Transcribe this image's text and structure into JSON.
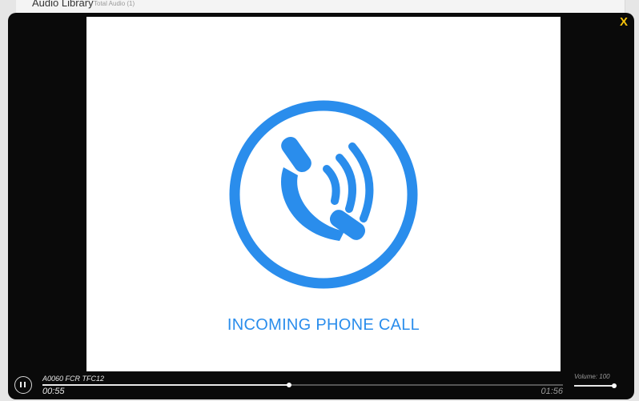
{
  "background_page": {
    "title": "Audio Library",
    "subtitle": "Total Audio (1)"
  },
  "modal": {
    "close_label": "X",
    "video": {
      "caption": "INCOMING PHONE CALL",
      "graphic_icon": "phone-ringing-icon",
      "accent_color": "#2a8dec"
    },
    "player": {
      "play_state": "playing",
      "control_icon": "pause-icon",
      "track_title": "A0060 FCR TFC12",
      "current_time": "00:55",
      "total_time": "01:56",
      "progress_fraction": 0.474,
      "volume_label": "Volume: 100",
      "volume_fraction": 1.0
    }
  }
}
